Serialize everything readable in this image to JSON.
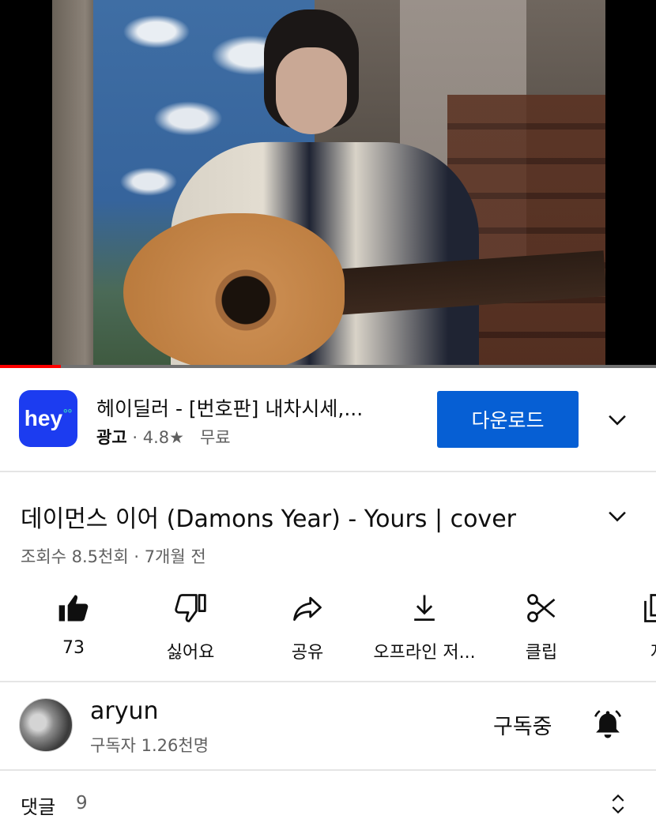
{
  "video": {
    "progress_fraction": 0.093
  },
  "ad": {
    "logo_text": "hey",
    "logo_dots": "°°",
    "title": "헤이딜러 - [번호판] 내차시세,...",
    "badge": "광고",
    "separator": "·",
    "rating": "4.8★",
    "price": "무료",
    "download_label": "다운로드",
    "brand_color": "#1c3cf0",
    "button_color": "#065fd4"
  },
  "title": {
    "text": "데이먼스 이어 (Damons Year) - Yours | cover",
    "meta": "조회수 8.5천회 · 7개월 전"
  },
  "actions": [
    {
      "label": "73",
      "icon": "thumbs-up-icon"
    },
    {
      "label": "싫어요",
      "icon": "thumbs-down-icon"
    },
    {
      "label": "공유",
      "icon": "share-icon"
    },
    {
      "label": "오프라인 저...",
      "icon": "download-icon"
    },
    {
      "label": "클립",
      "icon": "scissors-icon"
    },
    {
      "label": "저",
      "icon": "save-playlist-icon"
    }
  ],
  "channel": {
    "name": "aryun",
    "subscribers": "구독자 1.26천명",
    "subscribe_state": "구독중",
    "bell_icon": "bell-icon"
  },
  "comments": {
    "label": "댓글",
    "count": "9"
  }
}
